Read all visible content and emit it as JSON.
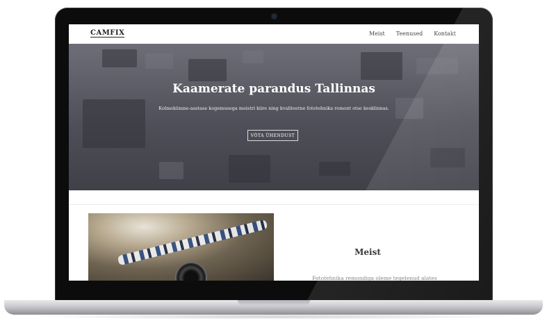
{
  "site": {
    "logo": "CAMFIX",
    "nav": [
      "Meist",
      "Teenused",
      "Kontakt"
    ]
  },
  "hero": {
    "title": "Kaamerate parandus Tallinnas",
    "subtitle": "Kolmekümne-aastase kogemusega meistri kiire ning kvaliteetne fototehnika remont otse kesklinnas.",
    "button": "VÕTA ÜHENDUST"
  },
  "about": {
    "title": "Meist",
    "text": "Fototehnika remondiga oleme tegelenud alates"
  },
  "colors": {
    "hero_overlay": "#4f4f59",
    "accent_white": "#ffffff"
  }
}
